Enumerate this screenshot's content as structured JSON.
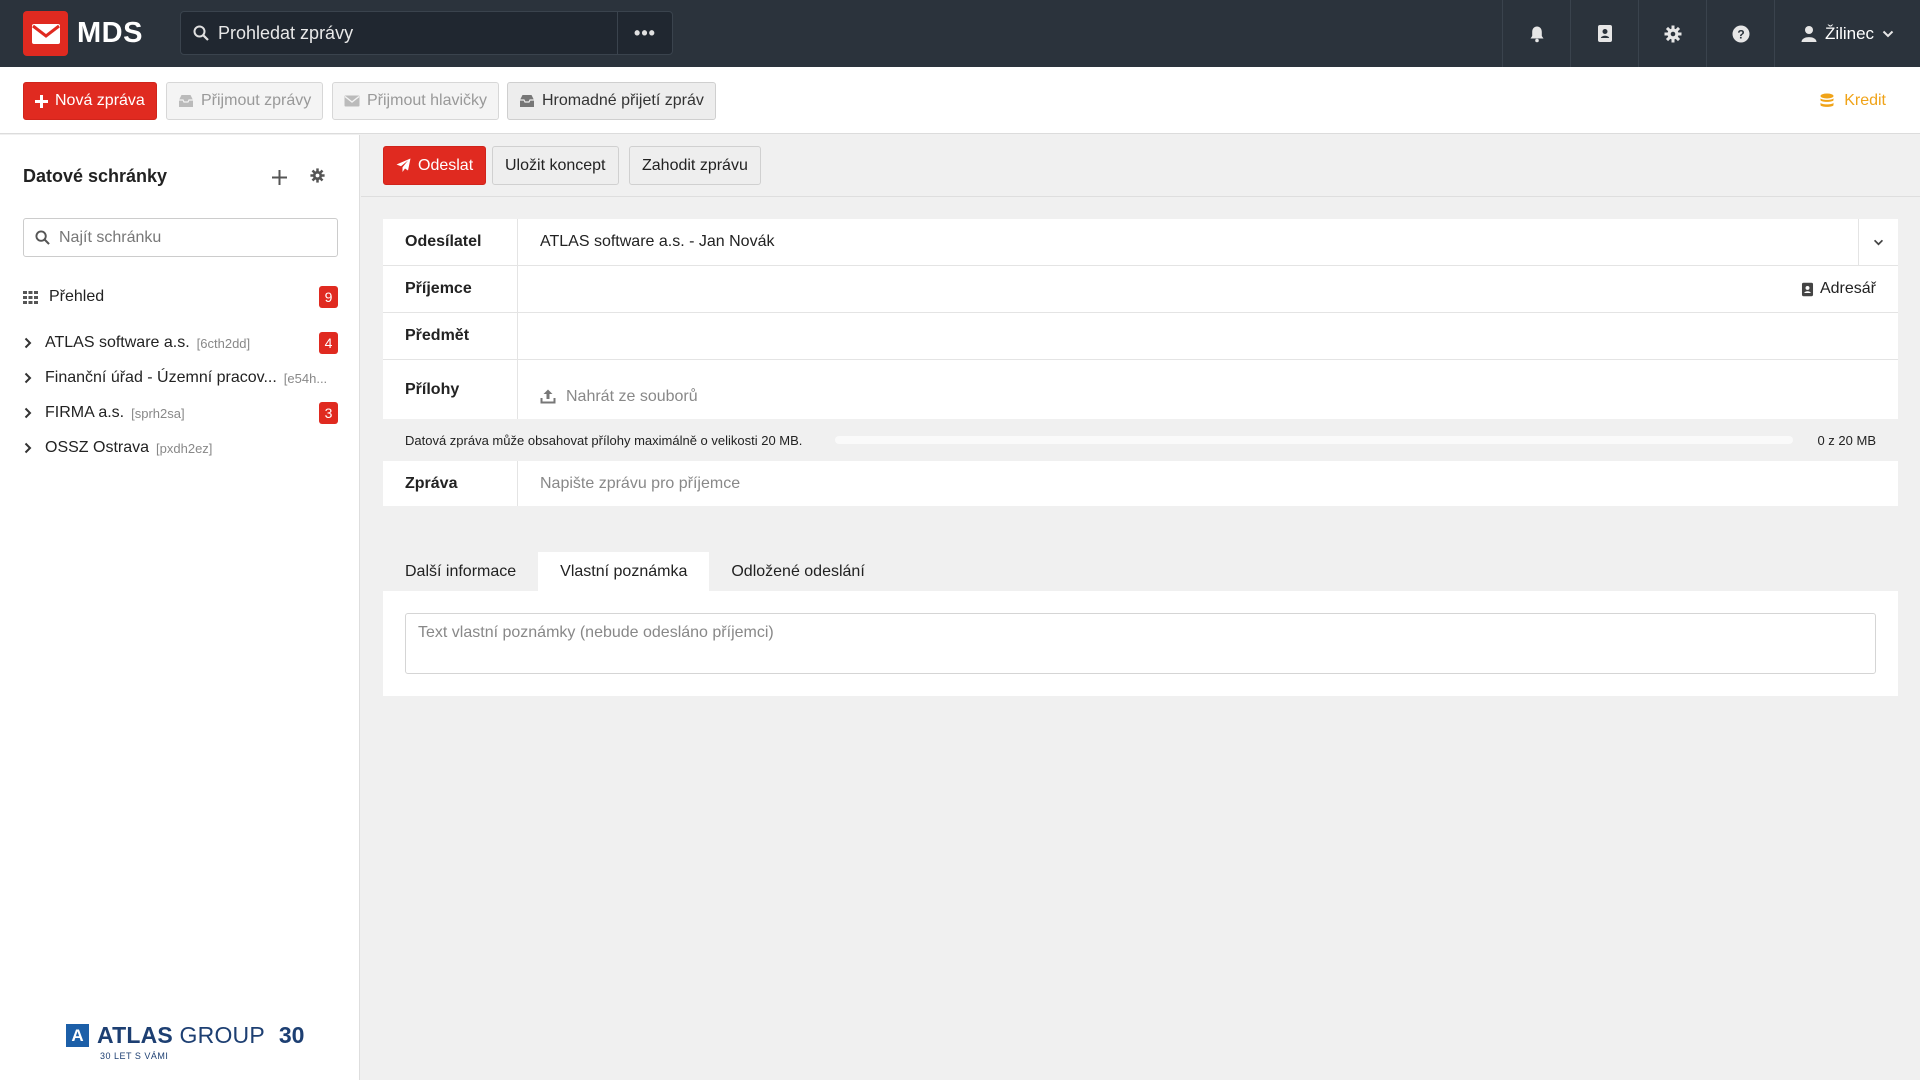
{
  "app": {
    "name": "MDS"
  },
  "header": {
    "search_placeholder": "Prohledat zprávy",
    "more_label": "•••",
    "user_name": "Žilinec"
  },
  "toolbar": {
    "new_message": "Nová zpráva",
    "receive_messages": "Přijmout zprávy",
    "receive_headers": "Přijmout hlavičky",
    "bulk_receive": "Hromadné přijetí zpráv",
    "credit": "Kredit"
  },
  "sidebar": {
    "title": "Datové schránky",
    "search_placeholder": "Najít schránku",
    "overview": {
      "label": "Přehled",
      "badge": "9"
    },
    "boxes": [
      {
        "label": "ATLAS software a.s.",
        "code": "[6cth2dd]",
        "badge": "4"
      },
      {
        "label": "Finanční úřad - Územní pracov...",
        "code": "[e54h...",
        "badge": ""
      },
      {
        "label": "FIRMA a.s.",
        "code": "[sprh2sa]",
        "badge": "3"
      },
      {
        "label": "OSSZ Ostrava",
        "code": "[pxdh2ez]",
        "badge": ""
      }
    ],
    "logo": {
      "brand_bold": "ATLAS",
      "brand_rest": " GROUP",
      "anniversary": "30",
      "tagline": "30 LET S VÁMI"
    }
  },
  "compose": {
    "send": "Odeslat",
    "save_draft": "Uložit koncept",
    "discard": "Zahodit zprávu",
    "fields": {
      "sender_label": "Odesílatel",
      "sender_value": "ATLAS software a.s. - Jan Novák",
      "recipient_label": "Příjemce",
      "address_book": "Adresář",
      "subject_label": "Předmět",
      "attachments_label": "Přílohy",
      "upload": "Nahrát ze souborů",
      "message_label": "Zpráva",
      "message_placeholder": "Napište zprávu pro příjemce"
    },
    "size_info": "Datová zpráva může obsahovat přílohy maximálně o velikosti 20 MB.",
    "size_count": "0 z 20 MB",
    "size_used_fraction": 0,
    "tabs": [
      "Další informace",
      "Vlastní poznámka",
      "Odložené odeslání"
    ],
    "active_tab": 1,
    "note_placeholder": "Text vlastní poznámky (nebude odesláno příjemci)"
  },
  "colors": {
    "accent": "#e02a20",
    "header_bg": "#2b333c",
    "credit": "#f0a318"
  }
}
